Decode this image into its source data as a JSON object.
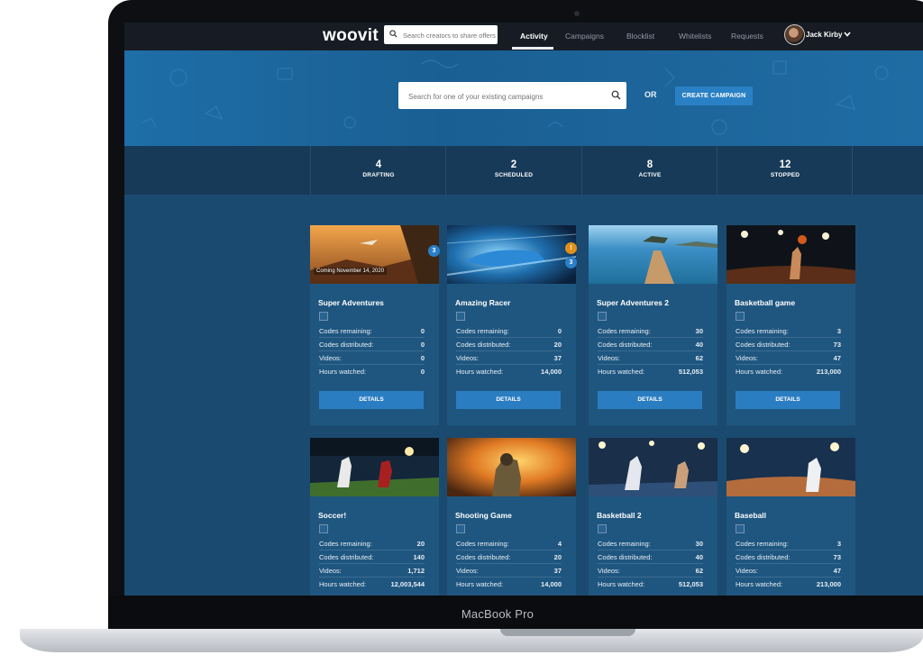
{
  "app": {
    "logo": "woovit"
  },
  "topbar": {
    "search_placeholder": "Search creators to share offers",
    "nav": [
      {
        "label": "Activity",
        "active": true
      },
      {
        "label": "Campaigns",
        "active": false
      },
      {
        "label": "Blocklist",
        "active": false
      },
      {
        "label": "Whitelists",
        "active": false
      },
      {
        "label": "Requests",
        "active": false
      }
    ],
    "user_name": "Jack Kirby"
  },
  "hero": {
    "search_placeholder": "Search for one of your existing campaigns",
    "or_label": "OR",
    "create_button": "CREATE CAMPAIGN"
  },
  "tabs": [
    {
      "count": "4",
      "label": "DRAFTING",
      "active": false
    },
    {
      "count": "2",
      "label": "SCHEDULED",
      "active": false
    },
    {
      "count": "8",
      "label": "ACTIVE",
      "active": true
    },
    {
      "count": "12",
      "label": "STOPPED",
      "active": false
    }
  ],
  "stat_labels": {
    "codes_remaining": "Codes remaining:",
    "codes_distributed": "Codes distributed:",
    "videos": "Videos:",
    "hours_watched": "Hours watched:"
  },
  "details_label": "DETAILS",
  "cards": [
    {
      "title": "Super Adventures",
      "codes_remaining": "0",
      "codes_distributed": "0",
      "videos": "0",
      "hours_watched": "0",
      "badge": "3",
      "caption": "Coming November 14, 2020",
      "thumb": "desert-adventure"
    },
    {
      "title": "Amazing Racer",
      "codes_remaining": "0",
      "codes_distributed": "20",
      "videos": "37",
      "hours_watched": "14,000",
      "badge": "3",
      "warning_badge": "!",
      "thumb": "race-car"
    },
    {
      "title": "Super Adventures 2",
      "codes_remaining": "30",
      "codes_distributed": "40",
      "videos": "62",
      "hours_watched": "512,053",
      "thumb": "sea-pier"
    },
    {
      "title": "Basketball game",
      "codes_remaining": "3",
      "codes_distributed": "73",
      "videos": "47",
      "hours_watched": "213,000",
      "thumb": "basketball-arena"
    },
    {
      "title": "Soccer!",
      "codes_remaining": "20",
      "codes_distributed": "140",
      "videos": "1,712",
      "hours_watched": "12,003,544",
      "thumb": "soccer-players"
    },
    {
      "title": "Shooting Game",
      "codes_remaining": "4",
      "codes_distributed": "20",
      "videos": "37",
      "hours_watched": "14,000",
      "thumb": "soldier-fire"
    },
    {
      "title": "Basketball 2",
      "codes_remaining": "30",
      "codes_distributed": "40",
      "videos": "62",
      "hours_watched": "512,053",
      "thumb": "basketball-dunk"
    },
    {
      "title": "Baseball",
      "codes_remaining": "3",
      "codes_distributed": "73",
      "videos": "47",
      "hours_watched": "213,000",
      "thumb": "baseball-stadium"
    }
  ],
  "device": {
    "label": "MacBook Pro"
  },
  "colors": {
    "accent": "#2b7dc2",
    "hero": "#1e6ea8",
    "background": "#1b4a70",
    "topbar": "#171c24"
  }
}
